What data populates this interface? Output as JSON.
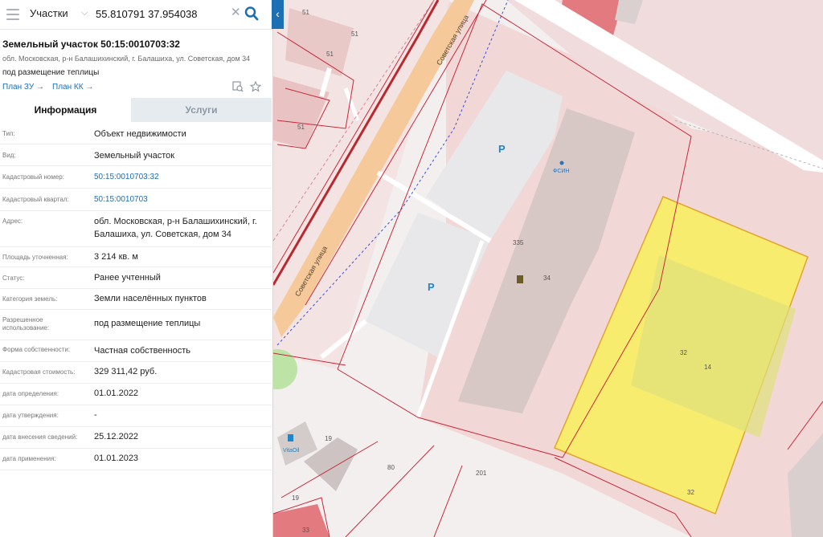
{
  "search": {
    "layer": "Участки",
    "query": "55.810791 37.954038"
  },
  "card": {
    "title": "Земельный участок 50:15:0010703:32",
    "address": "обл. Московская, р-н Балашихинский, г. Балашиха, ул. Советская, дом 34",
    "purpose": "под размещение теплицы",
    "plan_zu": "План ЗУ →",
    "plan_kk": "План КК →"
  },
  "tabs": [
    "Информация",
    "Услуги"
  ],
  "info": [
    {
      "label": "Тип:",
      "value": "Объект недвижимости"
    },
    {
      "label": "Вид:",
      "value": "Земельный участок"
    },
    {
      "label": "Кадастровый номер:",
      "value": "50:15:0010703:32"
    },
    {
      "label": "Кадастровый квартал:",
      "value": "50:15:0010703"
    },
    {
      "label": "Адрес:",
      "value": "обл. Московская, р-н Балашихинский, г. Балашиха, ул. Советская, дом 34"
    },
    {
      "label": "Площадь уточненная:",
      "value": "3 214 кв. м"
    },
    {
      "label": "Статус:",
      "value": "Ранее учтенный"
    },
    {
      "label": "Категория земель:",
      "value": "Земли населённых пунктов"
    },
    {
      "label": "Разрешенное использование:",
      "value": "под размещение теплицы"
    },
    {
      "label": "Форма собственности:",
      "value": "Частная собственность"
    },
    {
      "label": "Кадастровая стоимость:",
      "value": "329 311,42 руб."
    },
    {
      "label": "дата определения:",
      "value": "01.01.2022"
    },
    {
      "label": "дата утверждения:",
      "value": "-"
    },
    {
      "label": "дата внесения сведений:",
      "value": "25.12.2022"
    },
    {
      "label": "дата применения:",
      "value": "01.01.2023"
    }
  ],
  "map": {
    "street_label_1": "Советская улица",
    "street_label_2": "Советская улица",
    "parking_1": "P",
    "parking_2": "P",
    "fsin": "ФСИН",
    "vitaoil": "VitaOil",
    "numbers": {
      "n335": "335",
      "n34a": "34",
      "n32a": "32",
      "n14": "14",
      "n32b": "32",
      "n19a": "19",
      "n19b": "19",
      "n80": "80",
      "n201": "201",
      "n33": "33",
      "n51a": "51",
      "n51b": "51",
      "n51c": "51",
      "n51d": "51"
    }
  },
  "colors": {
    "accent": "#1c6fb2",
    "selected_parcel": "#f7ec6e",
    "parcel_border": "#c8283a",
    "road": "#f6c99a",
    "link": "#1e6db6"
  }
}
